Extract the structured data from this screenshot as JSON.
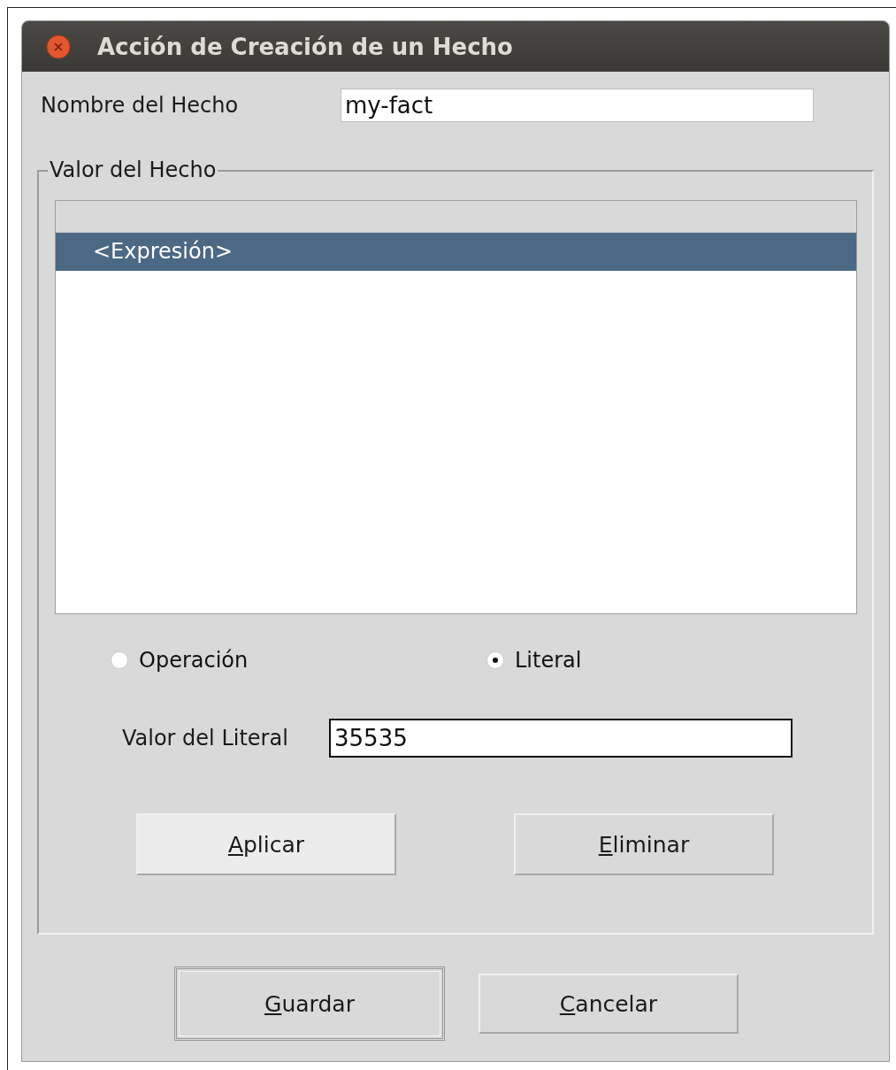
{
  "window": {
    "title": "Acción de Creación de un Hecho"
  },
  "fact_name": {
    "label": "Nombre del Hecho",
    "value": "my-fact"
  },
  "fact_value": {
    "legend": "Valor del Hecho",
    "tree": [
      {
        "label": "<Expresión>",
        "selected": true
      }
    ],
    "options": [
      {
        "label": "Operación",
        "selected": false
      },
      {
        "label": "Literal",
        "selected": true
      }
    ],
    "literal": {
      "label": "Valor del Literal",
      "value": "35535"
    },
    "buttons": [
      {
        "label": "Aplicar",
        "hovered": true
      },
      {
        "label": "Eliminar",
        "hovered": false
      }
    ]
  },
  "buttons": [
    {
      "label": "Guardar",
      "default": true
    },
    {
      "label": "Cancelar",
      "default": false
    }
  ]
}
